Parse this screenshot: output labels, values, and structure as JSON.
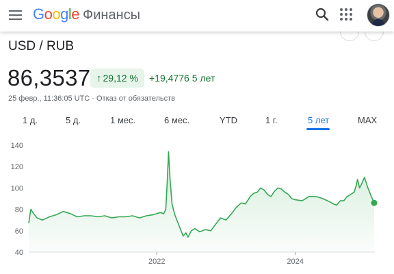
{
  "header": {
    "logo_letters": [
      "G",
      "o",
      "o",
      "g",
      "l",
      "e"
    ],
    "product": "Финансы",
    "icons": [
      "menu-icon",
      "search-icon",
      "apps-icon",
      "avatar"
    ]
  },
  "quote": {
    "pair": "USD / RUB",
    "price": "86,3537",
    "change_pct": "29,12 %",
    "change_abs": "+19,4776",
    "period": "5 лет",
    "timestamp": "25 февр., 11:36:05 UTC · Отказ от обязательств",
    "colors": {
      "positive": "#137333",
      "positive_bg": "#e6f4ea",
      "line": "#34a853",
      "accent": "#1a73e8"
    }
  },
  "tabs": [
    {
      "label": "1 д.",
      "active": false
    },
    {
      "label": "5 д.",
      "active": false
    },
    {
      "label": "1 мес.",
      "active": false
    },
    {
      "label": "6 мес.",
      "active": false
    },
    {
      "label": "YTD",
      "active": false
    },
    {
      "label": "1 г.",
      "active": false
    },
    {
      "label": "5 лет",
      "active": true
    },
    {
      "label": "MAX",
      "active": false
    }
  ],
  "chart_data": {
    "type": "area",
    "title": "",
    "xlabel": "",
    "ylabel": "",
    "ylim": [
      40,
      140
    ],
    "yticks": [
      40,
      60,
      80,
      100,
      120,
      140
    ],
    "xticks": [
      "2022",
      "2024"
    ],
    "xlim": [
      2020.15,
      2025.15
    ],
    "grid": false,
    "legend": "none",
    "x": [
      2020.15,
      2020.18,
      2020.22,
      2020.27,
      2020.35,
      2020.45,
      2020.55,
      2020.65,
      2020.75,
      2020.85,
      2020.95,
      2021.05,
      2021.15,
      2021.25,
      2021.35,
      2021.45,
      2021.55,
      2021.65,
      2021.75,
      2021.85,
      2021.95,
      2022.05,
      2022.1,
      2022.13,
      2022.15,
      2022.17,
      2022.19,
      2022.22,
      2022.26,
      2022.32,
      2022.38,
      2022.42,
      2022.45,
      2022.5,
      2022.55,
      2022.62,
      2022.7,
      2022.78,
      2022.85,
      2022.92,
      2023.0,
      2023.08,
      2023.15,
      2023.22,
      2023.28,
      2023.35,
      2023.4,
      2023.45,
      2023.5,
      2023.55,
      2023.6,
      2023.65,
      2023.7,
      2023.75,
      2023.8,
      2023.85,
      2023.9,
      2023.95,
      2024.0,
      2024.1,
      2024.2,
      2024.3,
      2024.4,
      2024.5,
      2024.55,
      2024.6,
      2024.65,
      2024.7,
      2024.75,
      2024.8,
      2024.85,
      2024.88,
      2024.9,
      2024.93,
      2024.96,
      2025.0,
      2025.05,
      2025.1,
      2025.14
    ],
    "series": [
      {
        "values": [
          67,
          80,
          76,
          72,
          70,
          73,
          75,
          78,
          76,
          73,
          74,
          74,
          73,
          74,
          72,
          73,
          73,
          74,
          72,
          74,
          75,
          77,
          76,
          80,
          105,
          134,
          110,
          85,
          75,
          65,
          55,
          58,
          54,
          60,
          62,
          59,
          61,
          60,
          66,
          72,
          70,
          76,
          82,
          86,
          85,
          92,
          95,
          96,
          100,
          98,
          94,
          92,
          97,
          100,
          99,
          96,
          94,
          90,
          89,
          88,
          92,
          92,
          90,
          87,
          85,
          84,
          88,
          88,
          92,
          94,
          96,
          102,
          108,
          100,
          104,
          110,
          100,
          92,
          86
        ]
      }
    ]
  }
}
